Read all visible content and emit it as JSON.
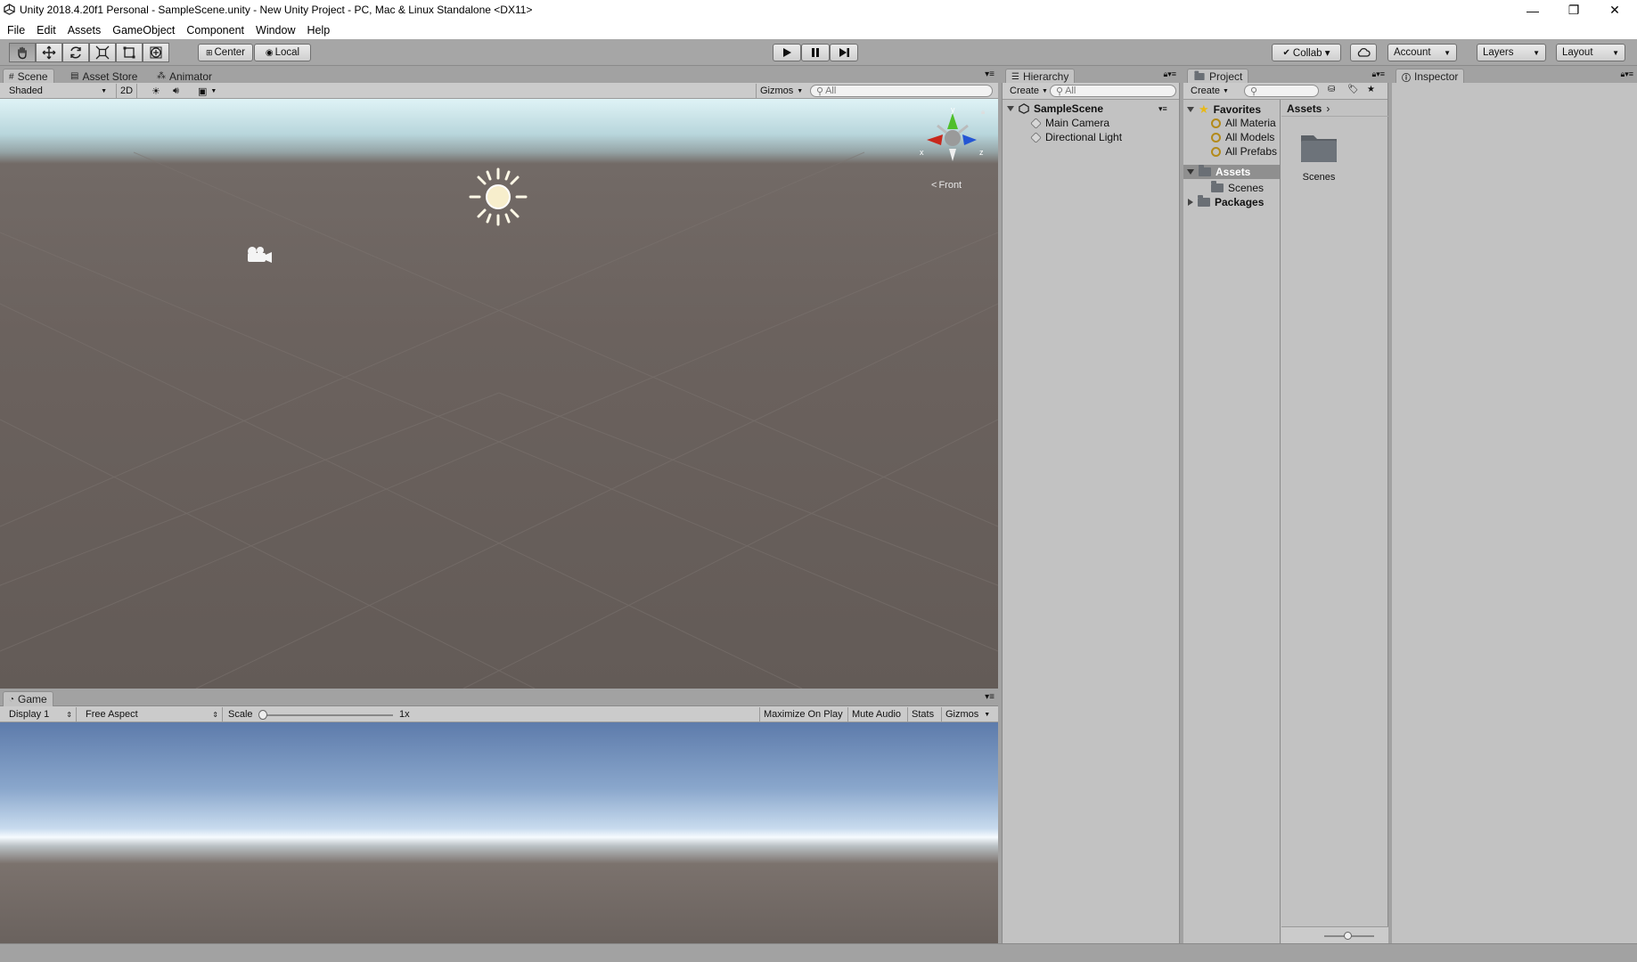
{
  "window": {
    "title": "Unity 2018.4.20f1 Personal - SampleScene.unity - New Unity Project - PC, Mac & Linux Standalone <DX11>",
    "minimize": "—",
    "restore": "❐",
    "close": "✕"
  },
  "menu": [
    "File",
    "Edit",
    "Assets",
    "GameObject",
    "Component",
    "Window",
    "Help"
  ],
  "toolbar": {
    "pivot": "Center",
    "space": "Local",
    "collab": "Collab ▾",
    "account": "Account",
    "layers": "Layers",
    "layout": "Layout"
  },
  "scene_panel": {
    "tabs": [
      "Scene",
      "Asset Store",
      "Animator"
    ],
    "shading": "Shaded",
    "mode_2d": "2D",
    "gizmos": "Gizmos",
    "search_placeholder": "All",
    "orientation": "Front",
    "axis_x": "x",
    "axis_y": "y",
    "axis_z": "z"
  },
  "game_panel": {
    "tab": "Game",
    "display": "Display 1",
    "aspect": "Free Aspect",
    "scale_label": "Scale",
    "scale_value": "1x",
    "maximize": "Maximize On Play",
    "mute": "Mute Audio",
    "stats": "Stats",
    "gizmos": "Gizmos"
  },
  "hierarchy": {
    "tab": "Hierarchy",
    "create": "Create",
    "search_placeholder": "All",
    "scene": "SampleScene",
    "items": [
      "Main Camera",
      "Directional Light"
    ]
  },
  "project": {
    "tab": "Project",
    "create": "Create",
    "favorites": "Favorites",
    "favorite_items": [
      "All Materia",
      "All Models",
      "All Prefabs"
    ],
    "assets": "Assets",
    "asset_children": [
      "Scenes"
    ],
    "packages": "Packages",
    "breadcrumb": "Assets",
    "grid_items": [
      "Scenes"
    ]
  },
  "inspector": {
    "tab": "Inspector"
  }
}
